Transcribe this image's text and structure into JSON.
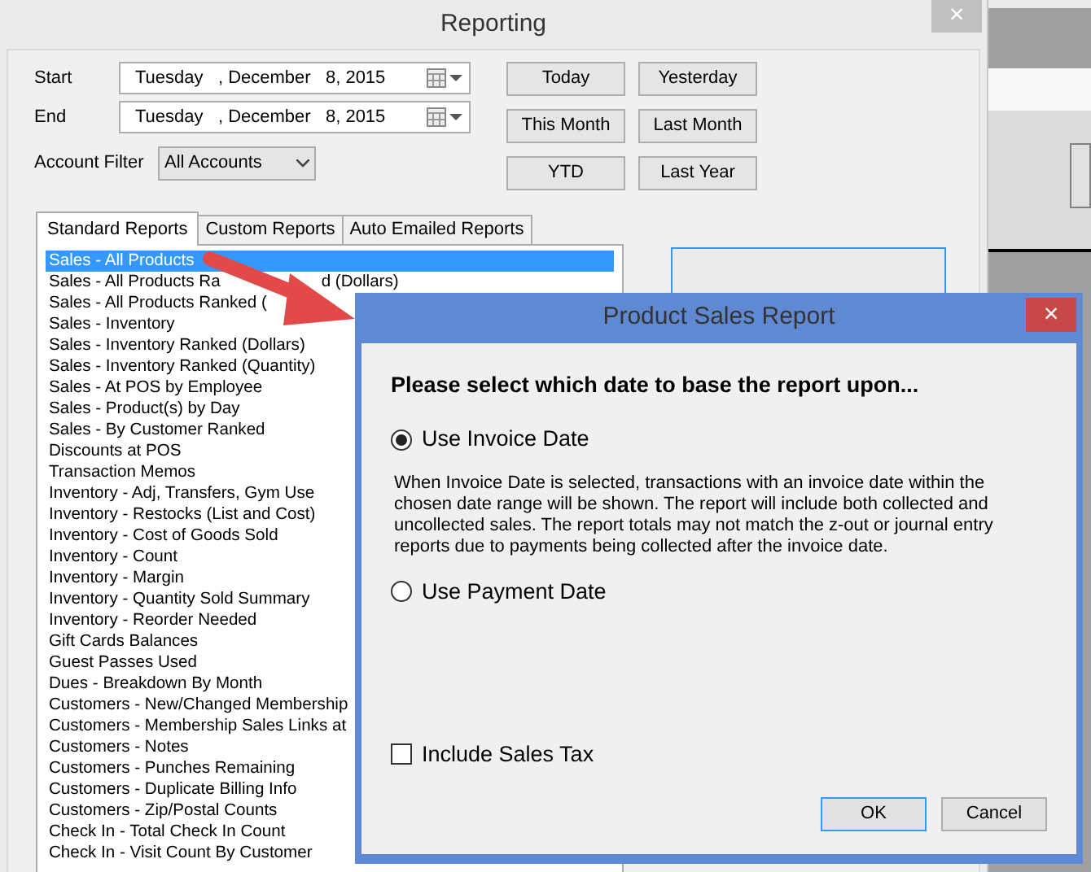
{
  "window": {
    "title": "Reporting",
    "close": "×"
  },
  "date_fields": [
    {
      "label": "Start",
      "value": "Tuesday   , December   8, 2015"
    },
    {
      "label": "End",
      "value": "Tuesday   , December   8, 2015"
    }
  ],
  "account_filter": {
    "label": "Account Filter",
    "value": "All Accounts"
  },
  "quick_buttons": [
    "Today",
    "Yesterday",
    "This Month",
    "Last Month",
    "YTD",
    "Last Year"
  ],
  "tabs": [
    {
      "label": "Standard Reports",
      "selected": true
    },
    {
      "label": "Custom Reports",
      "selected": false
    },
    {
      "label": "Auto Emailed Reports",
      "selected": false
    }
  ],
  "reports": [
    {
      "label": "Sales - All Products",
      "selected": true
    },
    {
      "label": "Sales - All Products Ra",
      "tail": "d (Dollars)",
      "selected": false
    },
    {
      "label": "Sales - All Products Ranked (",
      "selected": false
    },
    {
      "label": "Sales - Inventory",
      "selected": false
    },
    {
      "label": "Sales - Inventory Ranked (Dollars)",
      "selected": false
    },
    {
      "label": "Sales - Inventory Ranked (Quantity)",
      "selected": false
    },
    {
      "label": "Sales - At POS by Employee",
      "selected": false
    },
    {
      "label": "Sales - Product(s) by Day",
      "selected": false
    },
    {
      "label": "Sales - By Customer Ranked",
      "selected": false
    },
    {
      "label": "Discounts at POS",
      "selected": false
    },
    {
      "label": "Transaction Memos",
      "selected": false
    },
    {
      "label": "Inventory - Adj, Transfers, Gym Use",
      "selected": false
    },
    {
      "label": "Inventory - Restocks (List and Cost)",
      "selected": false
    },
    {
      "label": "Inventory - Cost of Goods Sold",
      "selected": false
    },
    {
      "label": "Inventory - Count",
      "selected": false
    },
    {
      "label": "Inventory - Margin",
      "selected": false
    },
    {
      "label": "Inventory - Quantity Sold Summary",
      "selected": false
    },
    {
      "label": "Inventory - Reorder Needed",
      "selected": false
    },
    {
      "label": "Gift Cards Balances",
      "selected": false
    },
    {
      "label": "Guest Passes Used",
      "selected": false
    },
    {
      "label": "Dues - Breakdown By Month",
      "selected": false
    },
    {
      "label": "Customers - New/Changed Membership",
      "selected": false
    },
    {
      "label": "Customers - Membership Sales Links at",
      "selected": false
    },
    {
      "label": "Customers - Notes",
      "selected": false
    },
    {
      "label": "Customers - Punches Remaining",
      "selected": false
    },
    {
      "label": "Customers - Duplicate Billing Info",
      "selected": false
    },
    {
      "label": "Customers - Zip/Postal Counts",
      "selected": false
    },
    {
      "label": "Check In - Total Check In Count",
      "selected": false
    },
    {
      "label": "Check In - Visit Count By Customer",
      "selected": false
    }
  ],
  "dialog": {
    "title": "Product Sales Report",
    "close": "×",
    "heading": "Please select which date to base the report upon...",
    "options": [
      {
        "label": "Use Invoice Date",
        "selected": true
      },
      {
        "label": "Use Payment Date",
        "selected": false
      }
    ],
    "description": "When Invoice Date is selected, transactions with an invoice date within the chosen date range will be shown.  The report will include both collected and uncollected sales.  The report totals may not match the z-out or journal entry reports due to payments being collected after the invoice date.",
    "include_sales_tax": {
      "label": "Include Sales Tax",
      "checked": false
    },
    "buttons": [
      {
        "label": "OK",
        "default": true
      },
      {
        "label": "Cancel",
        "default": false
      }
    ]
  }
}
